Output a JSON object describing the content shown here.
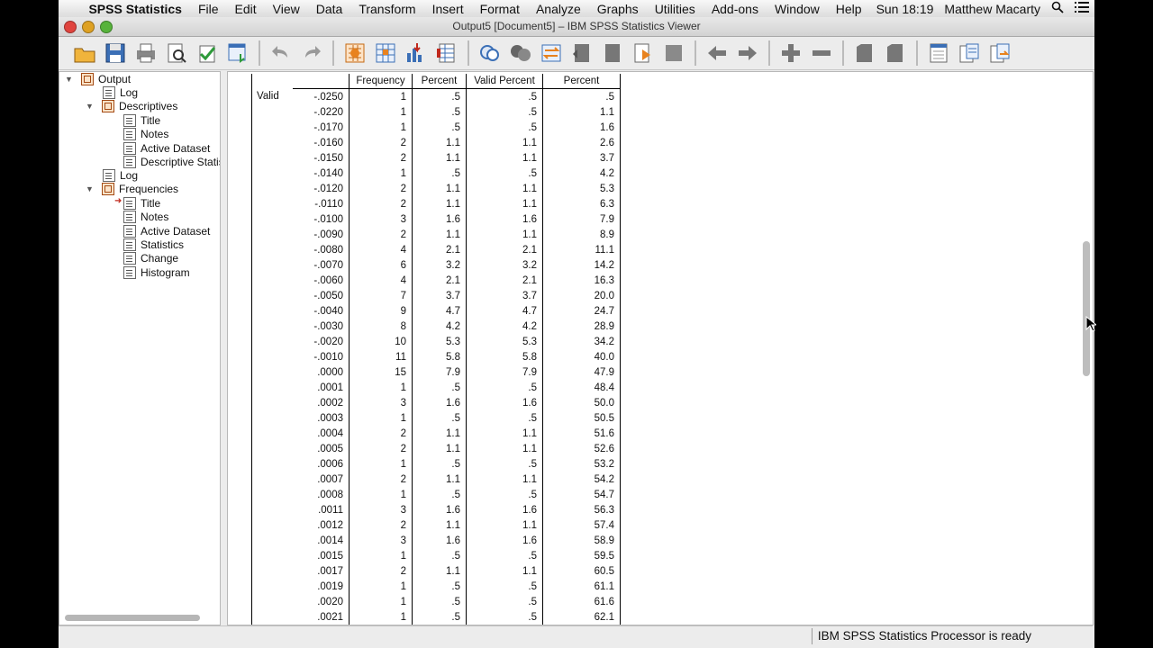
{
  "menubar": {
    "app_name": "SPSS Statistics",
    "items": [
      "File",
      "Edit",
      "View",
      "Data",
      "Transform",
      "Insert",
      "Format",
      "Analyze",
      "Graphs",
      "Utilities",
      "Add-ons",
      "Window",
      "Help"
    ],
    "clock": "Sun 18:19",
    "user": "Matthew Macarty"
  },
  "window": {
    "title": "Output5 [Document5] – IBM SPSS Statistics Viewer"
  },
  "outline": {
    "items": [
      {
        "label": "Output",
        "level": 0,
        "expanded": true,
        "icon": "output-book-icon"
      },
      {
        "label": "Log",
        "level": 1,
        "icon": "log-icon"
      },
      {
        "label": "Descriptives",
        "level": 1,
        "expanded": true,
        "icon": "book-icon"
      },
      {
        "label": "Title",
        "level": 2,
        "icon": "title-icon"
      },
      {
        "label": "Notes",
        "level": 2,
        "icon": "notes-icon"
      },
      {
        "label": "Active Dataset",
        "level": 2,
        "icon": "notes-icon"
      },
      {
        "label": "Descriptive Statis",
        "level": 2,
        "icon": "table-icon"
      },
      {
        "label": "Log",
        "level": 1,
        "icon": "log-icon"
      },
      {
        "label": "Frequencies",
        "level": 1,
        "expanded": true,
        "icon": "book-icon"
      },
      {
        "label": "Title",
        "level": 2,
        "icon": "title-icon",
        "current": true
      },
      {
        "label": "Notes",
        "level": 2,
        "icon": "notes-icon"
      },
      {
        "label": "Active Dataset",
        "level": 2,
        "icon": "notes-icon"
      },
      {
        "label": "Statistics",
        "level": 2,
        "icon": "table-icon"
      },
      {
        "label": "Change",
        "level": 2,
        "icon": "table-icon"
      },
      {
        "label": "Histogram",
        "level": 2,
        "icon": "chart-icon"
      }
    ]
  },
  "table": {
    "headers": [
      "",
      "",
      "Frequency",
      "Percent",
      "Valid Percent",
      "Percent"
    ],
    "group_label": "Valid",
    "rows": [
      [
        "-.0250",
        "1",
        ".5",
        ".5",
        ".5"
      ],
      [
        "-.0220",
        "1",
        ".5",
        ".5",
        "1.1"
      ],
      [
        "-.0170",
        "1",
        ".5",
        ".5",
        "1.6"
      ],
      [
        "-.0160",
        "2",
        "1.1",
        "1.1",
        "2.6"
      ],
      [
        "-.0150",
        "2",
        "1.1",
        "1.1",
        "3.7"
      ],
      [
        "-.0140",
        "1",
        ".5",
        ".5",
        "4.2"
      ],
      [
        "-.0120",
        "2",
        "1.1",
        "1.1",
        "5.3"
      ],
      [
        "-.0110",
        "2",
        "1.1",
        "1.1",
        "6.3"
      ],
      [
        "-.0100",
        "3",
        "1.6",
        "1.6",
        "7.9"
      ],
      [
        "-.0090",
        "2",
        "1.1",
        "1.1",
        "8.9"
      ],
      [
        "-.0080",
        "4",
        "2.1",
        "2.1",
        "11.1"
      ],
      [
        "-.0070",
        "6",
        "3.2",
        "3.2",
        "14.2"
      ],
      [
        "-.0060",
        "4",
        "2.1",
        "2.1",
        "16.3"
      ],
      [
        "-.0050",
        "7",
        "3.7",
        "3.7",
        "20.0"
      ],
      [
        "-.0040",
        "9",
        "4.7",
        "4.7",
        "24.7"
      ],
      [
        "-.0030",
        "8",
        "4.2",
        "4.2",
        "28.9"
      ],
      [
        "-.0020",
        "10",
        "5.3",
        "5.3",
        "34.2"
      ],
      [
        "-.0010",
        "11",
        "5.8",
        "5.8",
        "40.0"
      ],
      [
        ".0000",
        "15",
        "7.9",
        "7.9",
        "47.9"
      ],
      [
        ".0001",
        "1",
        ".5",
        ".5",
        "48.4"
      ],
      [
        ".0002",
        "3",
        "1.6",
        "1.6",
        "50.0"
      ],
      [
        ".0003",
        "1",
        ".5",
        ".5",
        "50.5"
      ],
      [
        ".0004",
        "2",
        "1.1",
        "1.1",
        "51.6"
      ],
      [
        ".0005",
        "2",
        "1.1",
        "1.1",
        "52.6"
      ],
      [
        ".0006",
        "1",
        ".5",
        ".5",
        "53.2"
      ],
      [
        ".0007",
        "2",
        "1.1",
        "1.1",
        "54.2"
      ],
      [
        ".0008",
        "1",
        ".5",
        ".5",
        "54.7"
      ],
      [
        ".0011",
        "3",
        "1.6",
        "1.6",
        "56.3"
      ],
      [
        ".0012",
        "2",
        "1.1",
        "1.1",
        "57.4"
      ],
      [
        ".0014",
        "3",
        "1.6",
        "1.6",
        "58.9"
      ],
      [
        ".0015",
        "1",
        ".5",
        ".5",
        "59.5"
      ],
      [
        ".0017",
        "2",
        "1.1",
        "1.1",
        "60.5"
      ],
      [
        ".0019",
        "1",
        ".5",
        ".5",
        "61.1"
      ],
      [
        ".0020",
        "1",
        ".5",
        ".5",
        "61.6"
      ],
      [
        ".0021",
        "1",
        ".5",
        ".5",
        "62.1"
      ]
    ]
  },
  "status": {
    "text": "IBM SPSS Statistics Processor is ready"
  },
  "colors": {
    "accent_orange": "#e8821e",
    "red_close": "#e0443e",
    "status_bg": "#ececec"
  }
}
